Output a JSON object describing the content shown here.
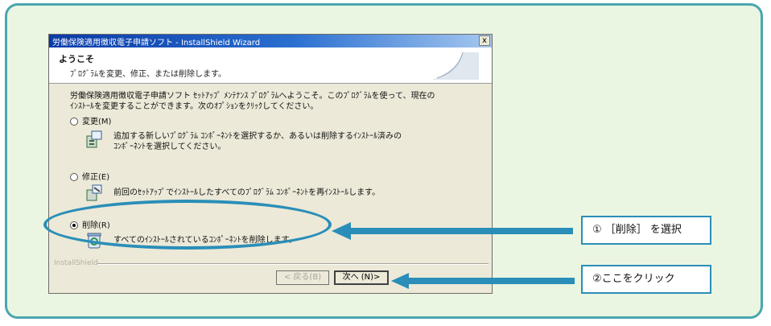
{
  "dialog": {
    "title": "労働保険適用徴収電子申請ソフト - InstallShield Wizard",
    "close_label": "x",
    "header_title": "ようこそ",
    "header_subtitle": "ﾌﾟﾛｸﾞﾗﾑを変更、修正、または削除します。",
    "intro_line1": "労働保険適用徴収電子申請ソフト ｾｯﾄｱｯﾌﾟ ﾒﾝﾃﾅﾝｽ ﾌﾟﾛｸﾞﾗﾑへようこそ。このﾌﾟﾛｸﾞﾗﾑを使って、現在の",
    "intro_line2": "ｲﾝｽﾄｰﾙを変更することができます。次のｵﾌﾟｼｮﾝをｸﾘｯｸしてください。",
    "options": [
      {
        "label": "変更(M)",
        "desc1": "追加する新しいﾌﾟﾛｸﾞﾗﾑ ｺﾝﾎﾟｰﾈﾝﾄを選択するか、あるいは削除するｲﾝｽﾄｰﾙ済みの",
        "desc2": "ｺﾝﾎﾟｰﾈﾝﾄを選択してください。",
        "selected": false,
        "icon": "modify-icon"
      },
      {
        "label": "修正(E)",
        "desc1": "前回のｾｯﾄｱｯﾌﾟでｲﾝｽﾄｰﾙしたすべてのﾌﾟﾛｸﾞﾗﾑ ｺﾝﾎﾟｰﾈﾝﾄを再ｲﾝｽﾄｰﾙします。",
        "desc2": "",
        "selected": false,
        "icon": "repair-icon"
      },
      {
        "label": "削除(R)",
        "desc1": "すべてのｲﾝｽﾄｰﾙされているｺﾝﾎﾟｰﾈﾝﾄを削除します。",
        "desc2": "",
        "selected": true,
        "icon": "remove-icon"
      }
    ],
    "brand": "InstallShield",
    "back_label": "< 戻る(B)",
    "next_label": "次へ (N)>"
  },
  "annotations": {
    "callout1": "① ［削除］ を選択",
    "callout2": "②ここをクリック"
  },
  "colors": {
    "panel_bg": "#eaf6e2",
    "panel_border": "#4aa6b0",
    "annotation_blue": "#2a8eb8"
  }
}
